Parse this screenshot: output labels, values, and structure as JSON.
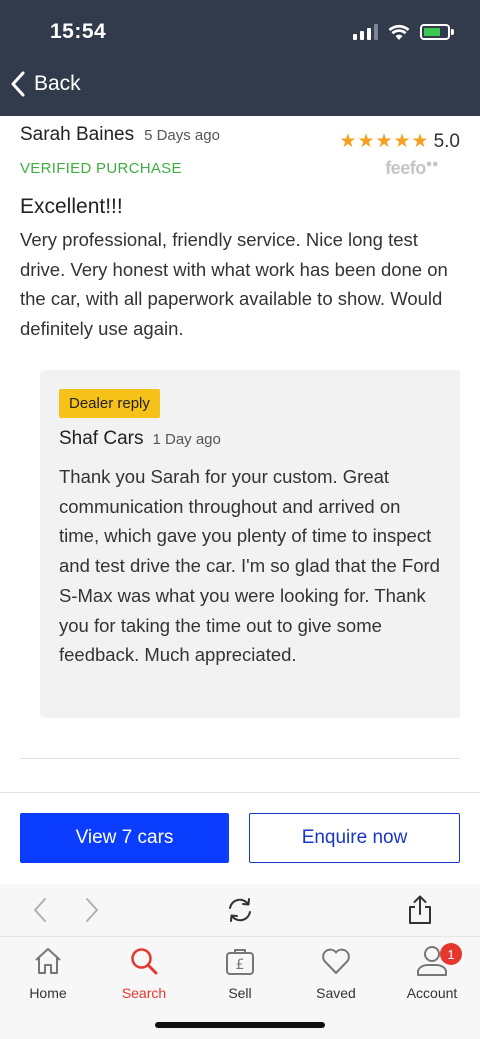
{
  "status_bar": {
    "time": "15:54"
  },
  "nav": {
    "back_label": "Back"
  },
  "review": {
    "reviewer": "Sarah Baines",
    "age": "5 Days ago",
    "rating": "5.0",
    "stars": "★★★★★",
    "provider": "feefo",
    "verified": "VERIFIED PURCHASE",
    "title": "Excellent!!!",
    "body": "Very professional, friendly service. Nice long test drive. Very honest with what work has been done on the car, with all paperwork available to show. Would definitely use again."
  },
  "dealer_reply": {
    "badge": "Dealer reply",
    "dealer": "Shaf Cars",
    "age": "1 Day ago",
    "body": "Thank you Sarah for your custom. Great communication throughout and arrived on time, which gave you plenty of time to inspect and test drive the car. I'm so glad that the Ford S-Max was what you were looking for. Thank you for taking the time out to give some feedback. Much appreciated."
  },
  "actions": {
    "view_cars": "View 7 cars",
    "enquire": "Enquire now"
  },
  "browser_toolbar": {
    "icons": [
      "back-arrow-icon",
      "forward-arrow-icon",
      "refresh-icon",
      "share-icon"
    ]
  },
  "tabs": [
    {
      "label": "Home",
      "icon": "home-icon"
    },
    {
      "label": "Search",
      "icon": "search-icon",
      "active": true
    },
    {
      "label": "Sell",
      "icon": "sell-pound-icon"
    },
    {
      "label": "Saved",
      "icon": "heart-icon"
    },
    {
      "label": "Account",
      "icon": "account-icon",
      "badge": "1"
    }
  ],
  "colors": {
    "header_bg": "#323b4c",
    "star": "#f4a11f",
    "verified": "#3fae42",
    "primary_button": "#0a3dff",
    "reply_badge": "#f6c21a",
    "active_tab": "#e6372f"
  }
}
